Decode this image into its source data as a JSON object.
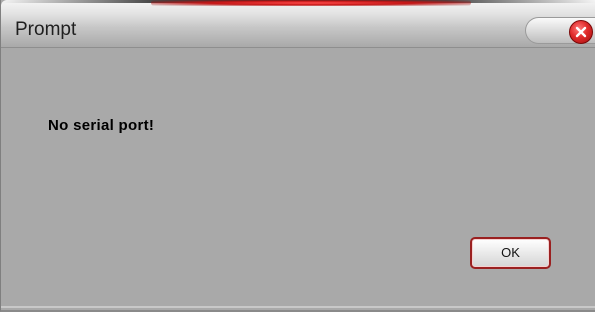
{
  "window": {
    "title": "Prompt"
  },
  "message": {
    "text": "No serial port!"
  },
  "buttons": {
    "ok_label": "OK"
  },
  "icons": {
    "close": "close-icon"
  },
  "colors": {
    "dialog_bg": "#a9a9a9",
    "accent_red": "#e02b2b",
    "button_border": "#9a2020"
  }
}
